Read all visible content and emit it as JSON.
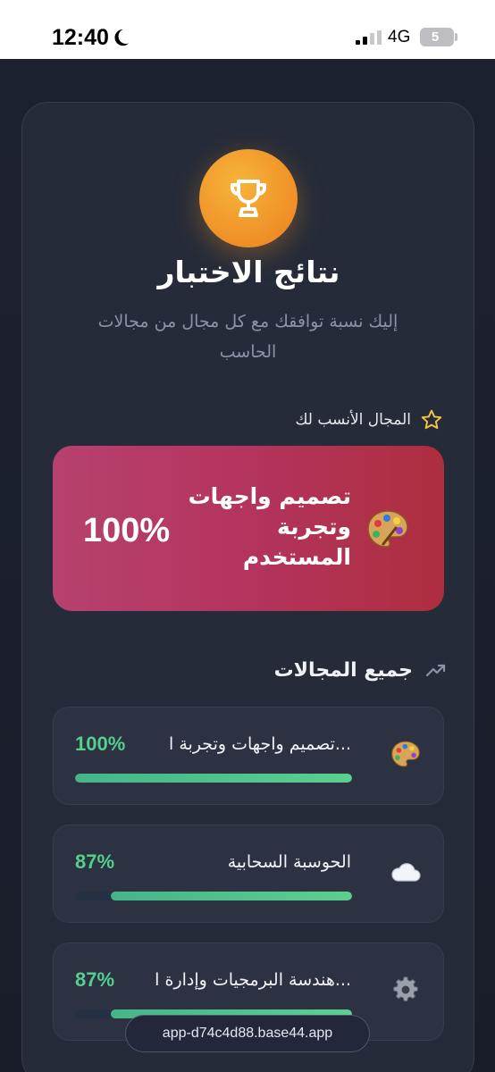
{
  "status_bar": {
    "time": "12:40",
    "network": "4G",
    "battery": "5"
  },
  "results": {
    "title": "نتائج الاختبار",
    "subtitle": "إليك نسبة توافقك مع كل مجال من مجالات الحاسب",
    "best_label": "المجال الأنسب لك",
    "best": {
      "name": "تصميم واجهات وتجربة المستخدم",
      "percent": "100%",
      "icon": "palette-icon"
    },
    "all_fields_title": "جميع المجالات",
    "fields": [
      {
        "name": "تصميم واجهات وتجربة ا...",
        "percent": "100%",
        "value": 1.0,
        "icon": "palette-icon"
      },
      {
        "name": "الحوسبة السحابية",
        "percent": "87%",
        "value": 0.87,
        "icon": "cloud-icon"
      },
      {
        "name": "هندسة البرمجيات وإدارة ا...",
        "percent": "87%",
        "value": 0.87,
        "icon": "gear-icon"
      }
    ]
  },
  "browser": {
    "url": "app-d74c4d88.base44.app"
  },
  "colors": {
    "accent_green": "#53cf8e",
    "best_card": "#b3345d",
    "trophy": "#f0962a",
    "background": "#1c2130"
  }
}
